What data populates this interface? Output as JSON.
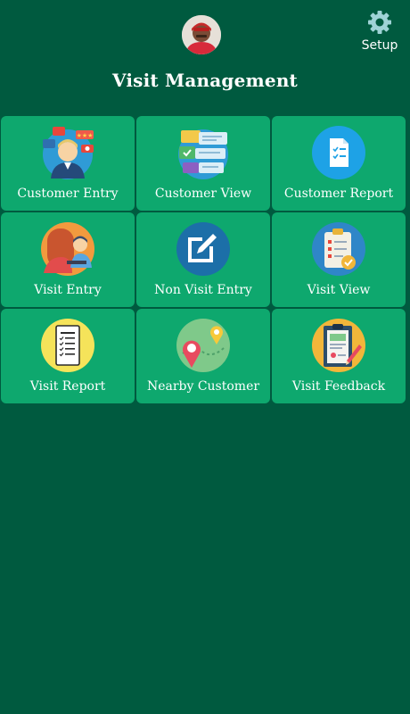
{
  "header": {
    "title": "Visit Management",
    "setup_label": "Setup",
    "avatar_icon": "user-avatar",
    "setup_icon": "gear-icon"
  },
  "tiles": [
    {
      "label": "Customer Entry",
      "icon": "customer-entry-icon"
    },
    {
      "label": "Customer View",
      "icon": "customer-view-icon"
    },
    {
      "label": "Customer Report",
      "icon": "customer-report-icon"
    },
    {
      "label": "Visit Entry",
      "icon": "visit-entry-icon"
    },
    {
      "label": "Non Visit Entry",
      "icon": "non-visit-entry-icon"
    },
    {
      "label": "Visit View",
      "icon": "visit-view-icon"
    },
    {
      "label": "Visit Report",
      "icon": "visit-report-icon"
    },
    {
      "label": "Nearby Customer",
      "icon": "nearby-customer-icon"
    },
    {
      "label": "Visit Feedback",
      "icon": "visit-feedback-icon"
    }
  ],
  "colors": {
    "background": "#005a3f",
    "tile": "#0ea86e",
    "text": "#ffffff",
    "gear": "#9fd3d6"
  }
}
